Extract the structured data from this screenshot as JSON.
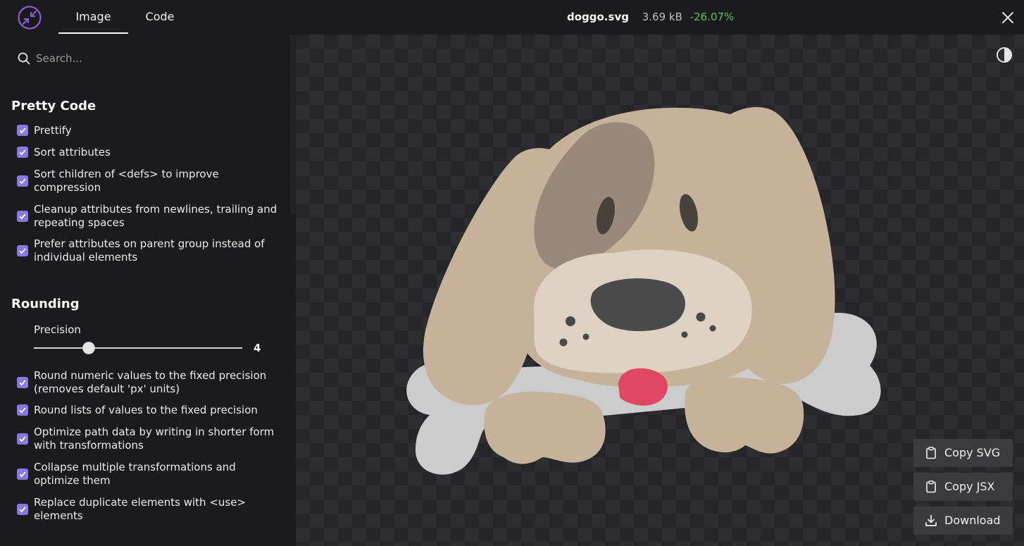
{
  "header": {
    "tabs": [
      {
        "label": "Image",
        "active": true
      },
      {
        "label": "Code",
        "active": false
      }
    ],
    "file": {
      "name": "doggo.svg",
      "size": "3.69 kB",
      "savings": "-26.07%"
    }
  },
  "sidebar": {
    "search": {
      "placeholder": "Search..."
    },
    "sections": [
      {
        "title": "Pretty Code",
        "options": [
          {
            "label": "Prettify",
            "checked": true
          },
          {
            "label": "Sort attributes",
            "checked": true
          },
          {
            "label": "Sort children of <defs> to improve compression",
            "checked": true
          },
          {
            "label": "Cleanup attributes from newlines, trailing and repeating spaces",
            "checked": true
          },
          {
            "label": "Prefer attributes on parent group instead of individual elements",
            "checked": true
          }
        ]
      },
      {
        "title": "Rounding",
        "precision": {
          "label": "Precision",
          "value": "4"
        },
        "options": [
          {
            "label": "Round numeric values to the fixed precision (removes default 'px' units)",
            "checked": true
          },
          {
            "label": "Round lists of values to the fixed precision",
            "checked": true
          },
          {
            "label": "Optimize path data by writing in shorter form with transformations",
            "checked": true
          },
          {
            "label": "Collapse multiple transformations and optimize them",
            "checked": true
          },
          {
            "label": "Replace duplicate elements with <use> elements",
            "checked": true
          }
        ]
      }
    ]
  },
  "preview": {
    "image": "dog-with-bone-illustration",
    "buttons": [
      {
        "label": "Copy SVG",
        "icon": "clipboard-icon"
      },
      {
        "label": "Copy JSX",
        "icon": "clipboard-icon"
      },
      {
        "label": "Download",
        "icon": "download-icon"
      }
    ]
  },
  "colors": {
    "accent": "#8a78e2",
    "logo": "#8e5bd6",
    "savings": "#4cc36b",
    "background": "#1b1b1d",
    "button": "#3b3b3e"
  }
}
